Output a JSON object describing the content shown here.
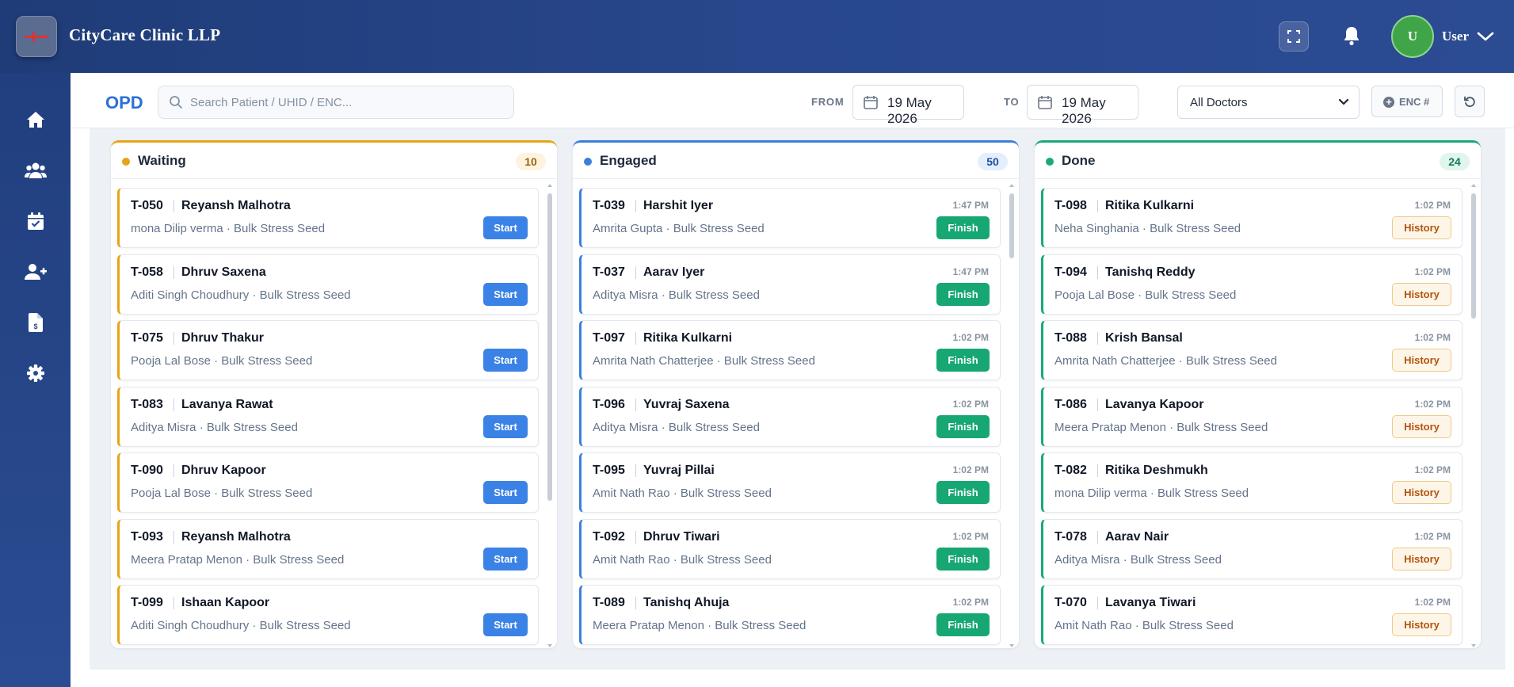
{
  "app": {
    "clinic_name": "CityCare Clinic LLP",
    "user_initial": "U",
    "user_label": "User"
  },
  "toolbar": {
    "title": "OPD",
    "search_placeholder": "Search Patient / UHID / ENC...",
    "from_label": "FROM",
    "from_date": "19 May 2026",
    "to_label": "TO",
    "to_date": "19 May 2026",
    "doctor_filter": "All Doctors",
    "enc_label": "ENC #"
  },
  "sidebar": {
    "icons": [
      "home-icon",
      "users-icon",
      "calendar-check-icon",
      "user-plus-icon",
      "invoice-icon",
      "gear-icon"
    ]
  },
  "columns": [
    {
      "key": "waiting",
      "title": "Waiting",
      "count": "10",
      "accent": "#e8a418",
      "cards": [
        {
          "token": "T-050",
          "name": "Reyansh Malhotra",
          "sub": "mona Dilip verma · Bulk Stress Seed",
          "time": "",
          "action": "Start"
        },
        {
          "token": "T-058",
          "name": "Dhruv Saxena",
          "sub": "Aditi Singh Choudhury · Bulk Stress Seed",
          "time": "",
          "action": "Start"
        },
        {
          "token": "T-075",
          "name": "Dhruv Thakur",
          "sub": "Pooja Lal Bose · Bulk Stress Seed",
          "time": "",
          "action": "Start"
        },
        {
          "token": "T-083",
          "name": "Lavanya Rawat",
          "sub": "Aditya Misra · Bulk Stress Seed",
          "time": "",
          "action": "Start"
        },
        {
          "token": "T-090",
          "name": "Dhruv Kapoor",
          "sub": "Pooja Lal Bose · Bulk Stress Seed",
          "time": "",
          "action": "Start"
        },
        {
          "token": "T-093",
          "name": "Reyansh Malhotra",
          "sub": "Meera Pratap Menon · Bulk Stress Seed",
          "time": "",
          "action": "Start"
        },
        {
          "token": "T-099",
          "name": "Ishaan Kapoor",
          "sub": "Aditi Singh Choudhury · Bulk Stress Seed",
          "time": "",
          "action": "Start"
        }
      ]
    },
    {
      "key": "engaged",
      "title": "Engaged",
      "count": "50",
      "accent": "#3b7fdb",
      "cards": [
        {
          "token": "T-039",
          "name": "Harshit Iyer",
          "sub": "Amrita Gupta · Bulk Stress Seed",
          "time": "1:47 PM",
          "action": "Finish"
        },
        {
          "token": "T-037",
          "name": "Aarav Iyer",
          "sub": "Aditya Misra · Bulk Stress Seed",
          "time": "1:47 PM",
          "action": "Finish"
        },
        {
          "token": "T-097",
          "name": "Ritika Kulkarni",
          "sub": "Amrita Nath Chatterjee · Bulk Stress Seed",
          "time": "1:02 PM",
          "action": "Finish"
        },
        {
          "token": "T-096",
          "name": "Yuvraj Saxena",
          "sub": "Aditya Misra · Bulk Stress Seed",
          "time": "1:02 PM",
          "action": "Finish"
        },
        {
          "token": "T-095",
          "name": "Yuvraj Pillai",
          "sub": "Amit Nath Rao · Bulk Stress Seed",
          "time": "1:02 PM",
          "action": "Finish"
        },
        {
          "token": "T-092",
          "name": "Dhruv Tiwari",
          "sub": "Amit Nath Rao · Bulk Stress Seed",
          "time": "1:02 PM",
          "action": "Finish"
        },
        {
          "token": "T-089",
          "name": "Tanishq Ahuja",
          "sub": "Meera Pratap Menon · Bulk Stress Seed",
          "time": "1:02 PM",
          "action": "Finish"
        }
      ]
    },
    {
      "key": "done",
      "title": "Done",
      "count": "24",
      "accent": "#19a97a",
      "cards": [
        {
          "token": "T-098",
          "name": "Ritika Kulkarni",
          "sub": "Neha Singhania · Bulk Stress Seed",
          "time": "1:02 PM",
          "action": "History"
        },
        {
          "token": "T-094",
          "name": "Tanishq Reddy",
          "sub": "Pooja Lal Bose · Bulk Stress Seed",
          "time": "1:02 PM",
          "action": "History"
        },
        {
          "token": "T-088",
          "name": "Krish Bansal",
          "sub": "Amrita Nath Chatterjee · Bulk Stress Seed",
          "time": "1:02 PM",
          "action": "History"
        },
        {
          "token": "T-086",
          "name": "Lavanya Kapoor",
          "sub": "Meera Pratap Menon · Bulk Stress Seed",
          "time": "1:02 PM",
          "action": "History"
        },
        {
          "token": "T-082",
          "name": "Ritika Deshmukh",
          "sub": "mona Dilip verma · Bulk Stress Seed",
          "time": "1:02 PM",
          "action": "History"
        },
        {
          "token": "T-078",
          "name": "Aarav Nair",
          "sub": "Aditya Misra · Bulk Stress Seed",
          "time": "1:02 PM",
          "action": "History"
        },
        {
          "token": "T-070",
          "name": "Lavanya Tiwari",
          "sub": "Amit Nath Rao · Bulk Stress Seed",
          "time": "1:02 PM",
          "action": "History"
        }
      ]
    }
  ]
}
